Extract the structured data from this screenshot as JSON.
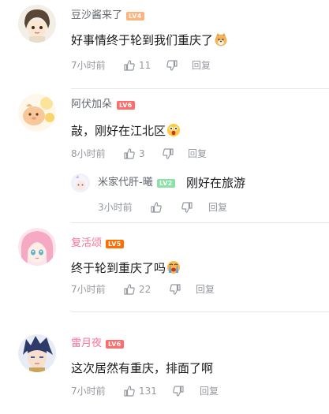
{
  "comments": [
    {
      "username": "豆沙酱来了",
      "level": "LV4",
      "level_color": "#ffb37c",
      "name_color": "#61666d",
      "text": "好事情终于轮到我们重庆了",
      "emoji": "doge-emoji",
      "time": "7小时前",
      "likes": "11",
      "reply_label": "回复"
    },
    {
      "username": "阿伏加朵",
      "level": "LV6",
      "level_color": "#ff6c6c",
      "name_color": "#61666d",
      "text": "敲，刚好在江北区",
      "emoji": "surprised-emoji",
      "time": "8小时前",
      "likes": "3",
      "reply_label": "回复",
      "reply": {
        "username": "米家代肝-曦",
        "level": "LV2",
        "level_color": "#8be2a6",
        "text": "刚好在旅游",
        "time": "3小时前",
        "reply_label": "回复"
      }
    },
    {
      "username": "复活颂",
      "level": "LV5",
      "level_color": "#ff6c00",
      "name_color": "#fb7299",
      "text": "终于轮到重庆了吗",
      "emoji": "crying-emoji",
      "time": "7小时前",
      "likes": "22",
      "reply_label": "回复"
    },
    {
      "username": "雷月夜",
      "level": "LV6",
      "level_color": "#ff6c6c",
      "name_color": "#fb7299",
      "text": "这次居然有重庆，排面了啊",
      "time": "7小时前",
      "likes": "131",
      "reply_label": "回复"
    }
  ]
}
